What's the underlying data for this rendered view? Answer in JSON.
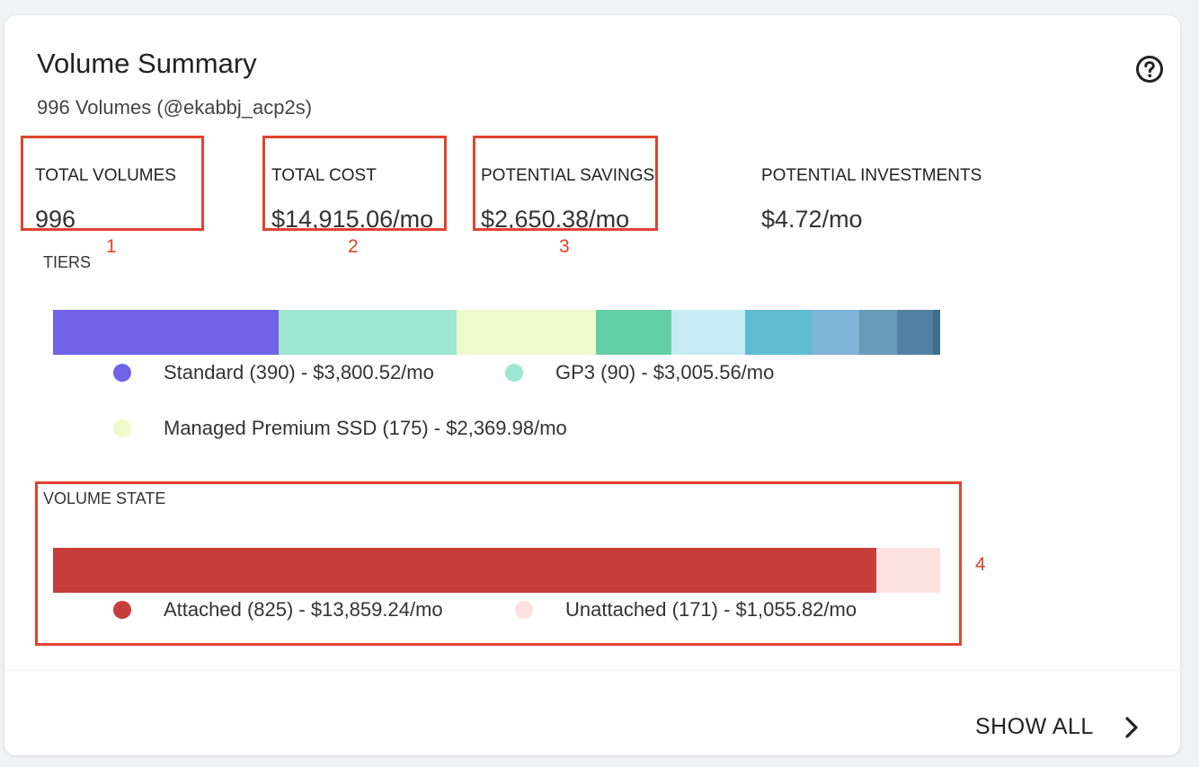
{
  "header": {
    "title": "Volume Summary",
    "subtitle": "996 Volumes (@ekabbj_acp2s)"
  },
  "metrics": [
    {
      "label": "TOTAL VOLUMES",
      "value": "996"
    },
    {
      "label": "TOTAL COST",
      "value": "$14,915.06/mo"
    },
    {
      "label": "POTENTIAL SAVINGS",
      "value": "$2,650.38/mo"
    },
    {
      "label": "POTENTIAL INVESTMENTS",
      "value": "$4.72/mo"
    }
  ],
  "tiers": {
    "label": "TIERS",
    "segments": [
      {
        "color": "#7163e8",
        "share": 0.254
      },
      {
        "color": "#9ce6d2",
        "share": 0.201
      },
      {
        "color": "#eefacb",
        "share": 0.157
      },
      {
        "color": "#64cea6",
        "share": 0.085
      },
      {
        "color": "#c7ebf5",
        "share": 0.083
      },
      {
        "color": "#5fbcd3",
        "share": 0.076
      },
      {
        "color": "#7fb3d8",
        "share": 0.053
      },
      {
        "color": "#679bb7",
        "share": 0.042
      },
      {
        "color": "#5181a0",
        "share": 0.041
      },
      {
        "color": "#3f6d8c",
        "share": 0.008
      }
    ],
    "legend": [
      {
        "text": "Standard (390) - $3,800.52/mo",
        "color": "#7163e8"
      },
      {
        "text": "GP3 (90) - $3,005.56/mo",
        "color": "#9ce6d2"
      },
      {
        "text": "Managed Premium SSD (175) - $2,369.98/mo",
        "color": "#eefacb"
      }
    ]
  },
  "volume_state": {
    "label": "VOLUME STATE",
    "segments": [
      {
        "color": "#c73d3a",
        "share": 0.928
      },
      {
        "color": "#fbe2e1",
        "share": 0.072
      }
    ],
    "legend": [
      {
        "text": "Attached (825) - $13,859.24/mo",
        "color": "#c73d3a"
      },
      {
        "text": "Unattached (171) - $1,055.82/mo",
        "color": "#fbe2e1"
      }
    ]
  },
  "annotations": [
    "1",
    "2",
    "3",
    "4"
  ],
  "footer": {
    "show_all_label": "SHOW ALL"
  },
  "icons": {
    "help": "question-circle-icon",
    "show_all": "chevron-right-icon"
  }
}
